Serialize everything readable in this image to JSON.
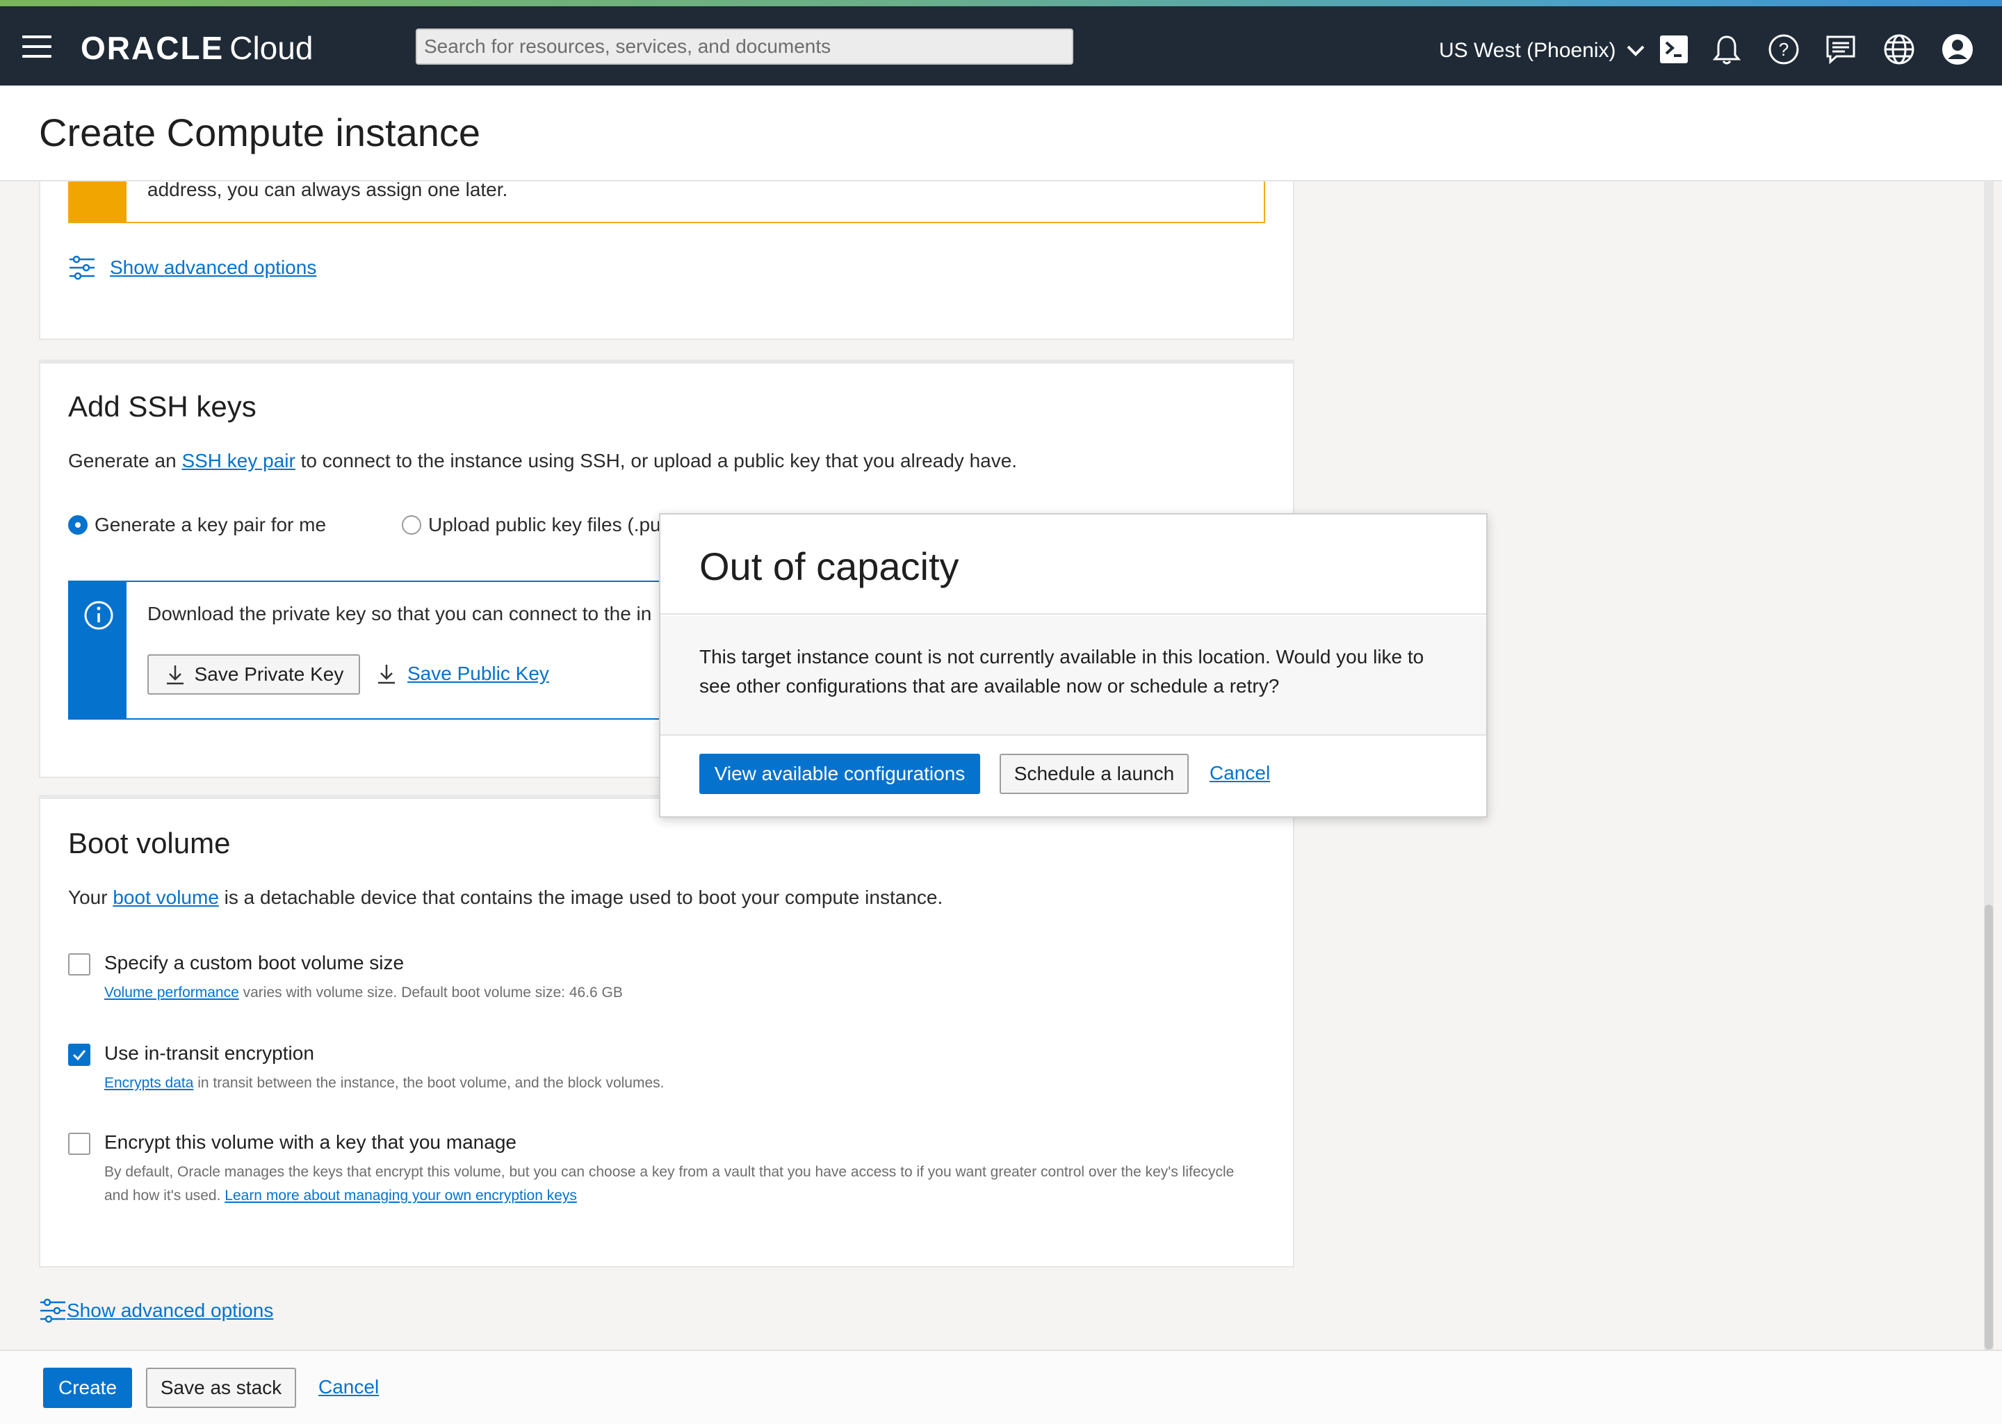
{
  "topbar": {
    "logo_brand": "ORACLE",
    "logo_product": "Cloud",
    "search_placeholder": "Search for resources, services, and documents",
    "region": "US West (Phoenix)",
    "icons": [
      "cloud-shell-icon",
      "bell-icon",
      "help-icon",
      "chat-icon",
      "globe-icon",
      "profile-icon"
    ]
  },
  "page": {
    "title": "Create Compute instance"
  },
  "networking": {
    "warning_text": "address, you can always assign one later.",
    "advanced_link": "Show advanced options"
  },
  "ssh": {
    "heading": "Add SSH keys",
    "desc_prefix": "Generate an ",
    "desc_link": "SSH key pair",
    "desc_suffix": " to connect to the instance using SSH, or upload a public key that you already have.",
    "option_generate": "Generate a key pair for me",
    "option_upload": "Upload public key files (.pu",
    "info_text": "Download the private key so that you can connect to the in",
    "save_private": "Save Private Key",
    "save_public": "Save Public Key"
  },
  "boot": {
    "heading": "Boot volume",
    "desc_prefix": "Your ",
    "desc_link": "boot volume",
    "desc_suffix": " is a detachable device that contains the image used to boot your compute instance.",
    "opt1_label": "Specify a custom boot volume size",
    "opt1_link": "Volume performance",
    "opt1_sub": " varies with volume size. Default boot volume size: 46.6 GB",
    "opt1_checked": false,
    "opt2_label": "Use in-transit encryption",
    "opt2_link": "Encrypts data",
    "opt2_sub": " in transit between the instance, the boot volume, and the block volumes.",
    "opt2_checked": true,
    "opt3_label": "Encrypt this volume with a key that you manage",
    "opt3_sub1": "By default, Oracle manages the keys that encrypt this volume, but you can choose a key from a vault that you have access to if you want greater control over the key's lifecycle",
    "opt3_sub2": "and how it's used. ",
    "opt3_link": "Learn more about managing your own encryption keys",
    "opt3_checked": false
  },
  "advanced_link_bottom": "Show advanced options",
  "footer": {
    "create": "Create",
    "save_stack": "Save as stack",
    "cancel": "Cancel"
  },
  "modal": {
    "title": "Out of capacity",
    "body": "This target instance count is not currently available in this location. Would you like to see other configurations that are available now or schedule a retry?",
    "primary": "View available configurations",
    "secondary": "Schedule a launch",
    "cancel": "Cancel"
  },
  "colors": {
    "topbar": "#1f2a36",
    "accent": "#0572ce",
    "warning": "#f0a500"
  }
}
